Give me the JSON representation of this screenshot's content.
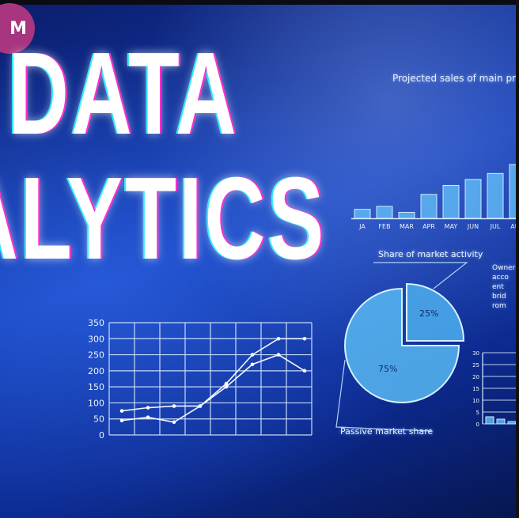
{
  "badge": {
    "text": "M"
  },
  "title": {
    "line1": "DATA",
    "line2": "ALYTICS"
  },
  "bar_panel": {
    "caption": "Projected sales of main produ",
    "categories": [
      "JA",
      "FEB",
      "MAR",
      "APR",
      "MAY",
      "JUN",
      "JUL",
      "AUG"
    ],
    "values": [
      3,
      4,
      2,
      8,
      11,
      13,
      15,
      18
    ]
  },
  "pie_panel": {
    "caption": "Share of market activity",
    "bottom_caption": "Passive market share",
    "slice_big_label": "75%",
    "slice_small_label": "25%",
    "side_text": [
      "Owner",
      "acco",
      "ent",
      "brid",
      "rom"
    ]
  },
  "line_panel": {
    "y_ticks": [
      "350",
      "300",
      "250",
      "200",
      "150",
      "100",
      "50",
      "0"
    ],
    "series": [
      {
        "values": [
          45,
          55,
          40,
          90,
          160,
          250,
          300,
          300
        ]
      },
      {
        "values": [
          75,
          85,
          90,
          90,
          150,
          220,
          250,
          200
        ]
      }
    ]
  },
  "mini_panel": {
    "y_ticks": [
      "30",
      "25",
      "20",
      "15",
      "10",
      "5",
      "0"
    ],
    "values": [
      3,
      2,
      1
    ]
  },
  "colors": {
    "accent_magenta": "#ff2fd0",
    "accent_cyan": "#30e8ff",
    "badge": "#a8357f"
  }
}
